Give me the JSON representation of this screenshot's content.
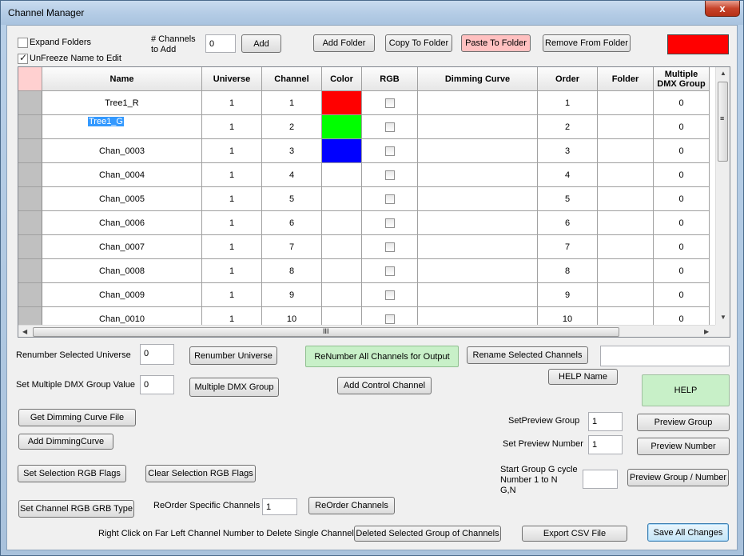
{
  "window": {
    "title": "Channel Manager",
    "close_glyph": "x"
  },
  "options": {
    "expand_folders": {
      "label": "Expand Folders",
      "checked": false
    },
    "unfreeze_name": {
      "label": "UnFreeze Name to Edit",
      "checked": true
    },
    "channels_to_add_label": "# Channels\nto Add",
    "channels_to_add_value": "0",
    "current_color": "#ff0000"
  },
  "toolbar": {
    "add": "Add",
    "add_folder": "Add Folder",
    "copy_to_folder": "Copy To Folder",
    "paste_to_folder": "Paste To Folder",
    "remove_from_folder": "Remove From Folder"
  },
  "grid": {
    "columns": [
      "Name",
      "Universe",
      "Channel",
      "Color",
      "RGB",
      "Dimming Curve",
      "Order",
      "Folder",
      "Multiple DMX Group"
    ],
    "rows": [
      {
        "name": "Tree1_R",
        "universe": "1",
        "channel": "1",
        "color": "#ff0000",
        "order": "1",
        "dmx": "0"
      },
      {
        "name": "Tree1_G",
        "universe": "1",
        "channel": "2",
        "color": "#00ff00",
        "order": "2",
        "dmx": "0",
        "editing": true
      },
      {
        "name": "Chan_0003",
        "universe": "1",
        "channel": "3",
        "color": "#0000ff",
        "order": "3",
        "dmx": "0"
      },
      {
        "name": "Chan_0004",
        "universe": "1",
        "channel": "4",
        "color": "",
        "order": "4",
        "dmx": "0"
      },
      {
        "name": "Chan_0005",
        "universe": "1",
        "channel": "5",
        "color": "",
        "order": "5",
        "dmx": "0"
      },
      {
        "name": "Chan_0006",
        "universe": "1",
        "channel": "6",
        "color": "",
        "order": "6",
        "dmx": "0"
      },
      {
        "name": "Chan_0007",
        "universe": "1",
        "channel": "7",
        "color": "",
        "order": "7",
        "dmx": "0"
      },
      {
        "name": "Chan_0008",
        "universe": "1",
        "channel": "8",
        "color": "",
        "order": "8",
        "dmx": "0"
      },
      {
        "name": "Chan_0009",
        "universe": "1",
        "channel": "9",
        "color": "",
        "order": "9",
        "dmx": "0"
      },
      {
        "name": "Chan_0010",
        "universe": "1",
        "channel": "10",
        "color": "",
        "order": "10",
        "dmx": "0"
      }
    ],
    "scroll_grip": "III",
    "vscroll_grip": "≡"
  },
  "controls": {
    "renumber_selected_universe_label": "Renumber Selected Universe",
    "renumber_selected_universe_value": "0",
    "renumber_universe": "Renumber Universe",
    "renumber_all": "ReNumber All Channels for Output",
    "rename_selected": "Rename Selected Channels",
    "rename_value": "",
    "help_name": "HELP Name",
    "help": "HELP",
    "set_multiple_dmx_label": "Set Multiple DMX Group Value",
    "set_multiple_dmx_value": "0",
    "multiple_dmx_group": "Multiple DMX Group",
    "add_control_channel": "Add Control Channel",
    "get_dimming_curve_file": "Get Dimming Curve File",
    "add_dimming_curve": "Add DimmingCurve",
    "set_preview_group_label": "SetPreview Group",
    "set_preview_group_value": "1",
    "preview_group": "Preview Group",
    "set_preview_number_label": "Set Preview Number",
    "set_preview_number_value": "1",
    "preview_number": "Preview Number",
    "start_group_label": "Start Group G cycle\nNumber 1 to N\nG,N",
    "start_group_value": "",
    "preview_group_number": "Preview Group / Number",
    "set_selection_rgb": "Set Selection RGB Flags",
    "clear_selection_rgb": "Clear Selection RGB Flags",
    "set_channel_rgb_grb": "Set Channel RGB GRB Type",
    "reorder_specific_label": "ReOrder Specific Channels",
    "reorder_specific_value": "1",
    "reorder_channels": "ReOrder Channels",
    "right_click_hint": "Right Click on Far Left Channel Number to Delete Single Channel",
    "delete_selected_group": "Deleted Selected Group of Channels",
    "export_csv": "Export CSV File",
    "save_all": "Save All Changes"
  }
}
